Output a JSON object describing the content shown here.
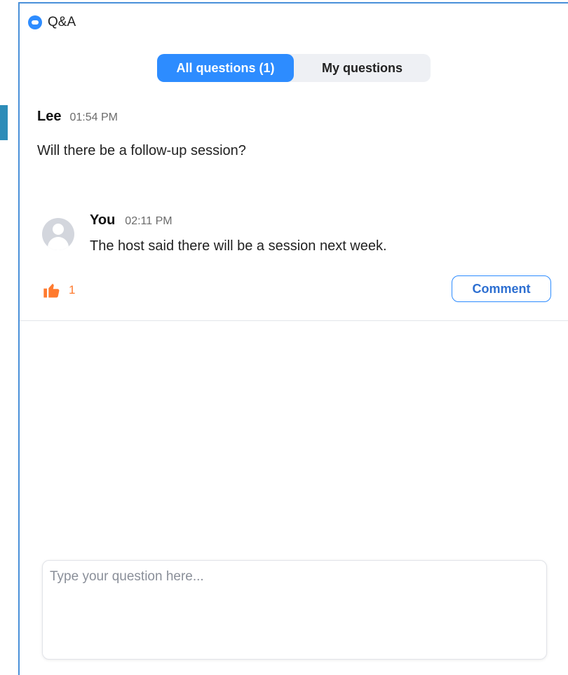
{
  "window": {
    "title": "Q&A"
  },
  "tabs": [
    {
      "label": "All questions  (1)",
      "active": true
    },
    {
      "label": "My questions",
      "active": false
    }
  ],
  "question": {
    "author": "Lee",
    "time": "01:54 PM",
    "text": "Will there be a follow-up session?"
  },
  "answer": {
    "author": "You",
    "time": "02:11 PM",
    "text": "The host said there will be a session next week.",
    "avatar_icon": "user-avatar-icon"
  },
  "likes": {
    "icon": "thumbs-up-icon",
    "count": "1"
  },
  "comment_button": {
    "label": "Comment"
  },
  "question_input": {
    "placeholder": "Type your question here...",
    "value": ""
  },
  "colors": {
    "accent": "#2d8cff",
    "like": "#ff7a2e",
    "window_border": "#4a90d9"
  }
}
